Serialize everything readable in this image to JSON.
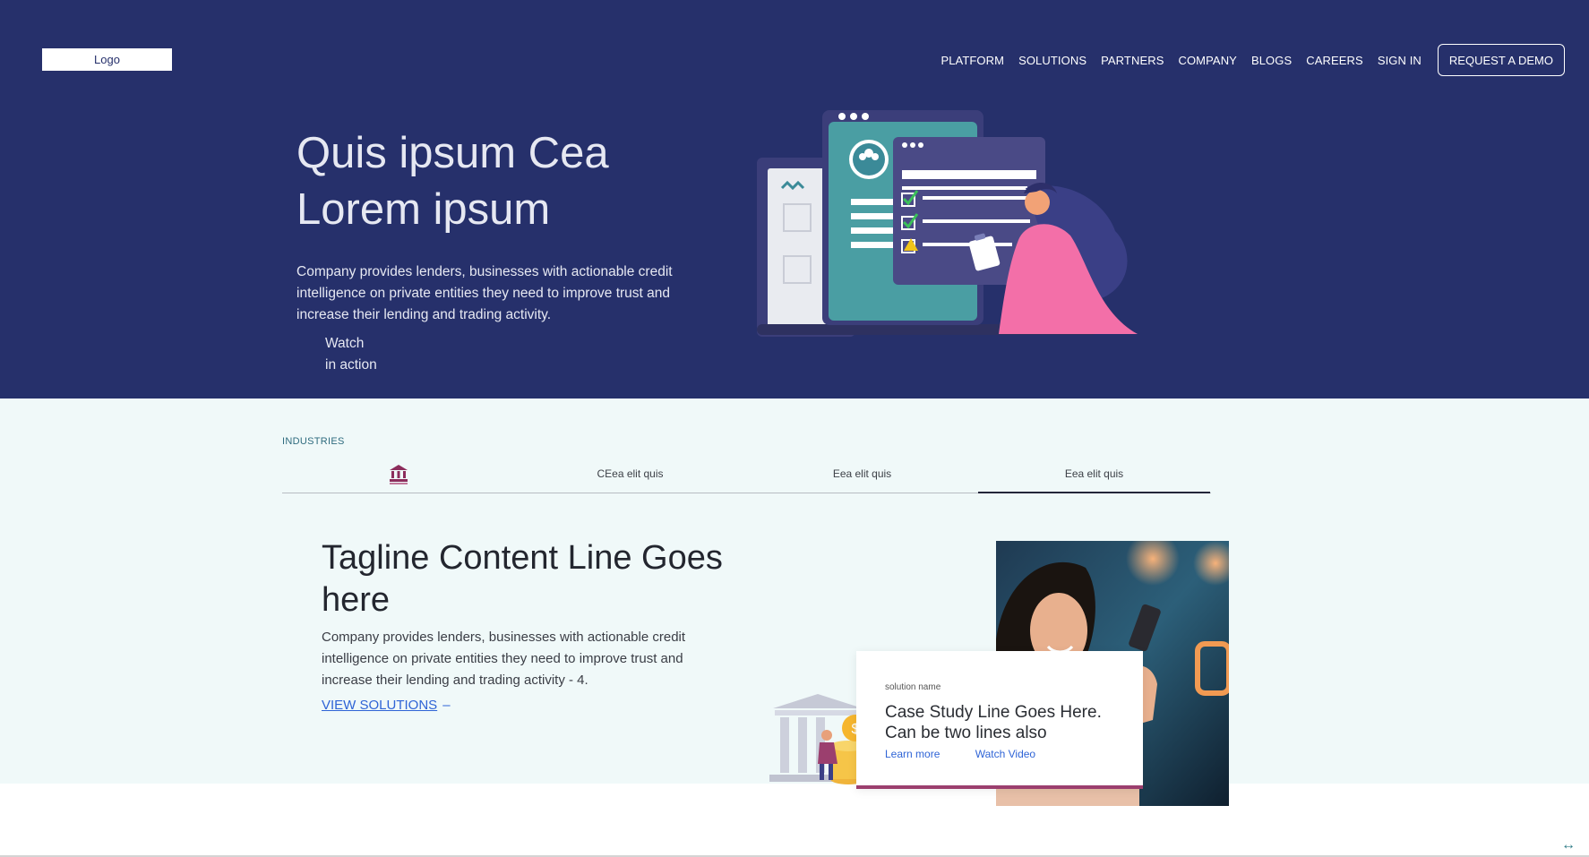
{
  "header": {
    "logo": "Logo",
    "nav": [
      "PLATFORM",
      "SOLUTIONS",
      "PARTNERS",
      "COMPANY",
      "BLOGS",
      "CAREERS",
      "SIGN IN"
    ],
    "cta": "REQUEST A DEMO"
  },
  "hero": {
    "title_line1": "Quis ipsum Cea",
    "title_line2": "Lorem ipsum",
    "description": "Company provides lenders, businesses with actionable credit intelligence on private entities they need to improve trust and increase their lending and trading activity.",
    "watch_line1": "Watch",
    "watch_line2": "in action"
  },
  "industries": {
    "label": "INDUSTRIES",
    "tabs": [
      "",
      "CEea elit quis",
      "Eea elit quis",
      "Eea elit quis"
    ],
    "active_tab": 3,
    "tagline": "Tagline Content Line Goes here",
    "description": "Company provides lenders, businesses with actionable credit intelligence on private entities they need to improve trust and increase their lending and trading activity - 4.",
    "view_link": "VIEW SOLUTIONS",
    "case": {
      "small": "solution name",
      "title": "Case Study Line Goes Here. Can be two lines also",
      "link1": "Learn more",
      "link2": "Watch Video"
    }
  },
  "colors": {
    "hero_bg": "#26306b",
    "industries_bg": "#f0f9f9",
    "accent_link": "#2f64d6",
    "card_border": "#9b3f6e"
  },
  "icons": [
    "bank-icon",
    "expand-arrows-icon"
  ]
}
